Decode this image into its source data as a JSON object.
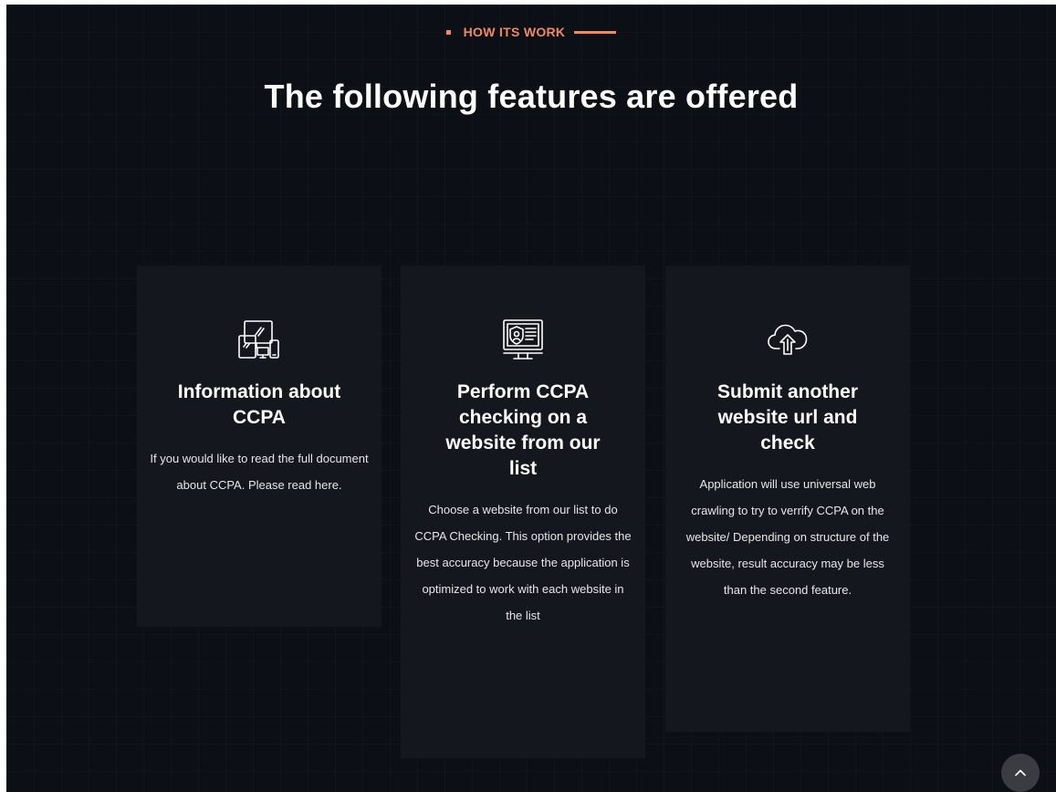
{
  "section": {
    "eyebrow": "HOW ITS WORK",
    "heading": "The following features are offered",
    "accent_color": "#f08a5d"
  },
  "cards": [
    {
      "icon": "devices-icon",
      "title": "Information about CCPA",
      "description": "If you would like to read the full document about CCPA. Please read here."
    },
    {
      "icon": "secure-monitor-icon",
      "title": "Perform CCPA checking on a website from our list",
      "description": "Choose a website from our list to do CCPA Checking. This option provides the best accuracy because the application is optimized to work with each website in the list"
    },
    {
      "icon": "cloud-upload-icon",
      "title": "Submit another website url and check",
      "description": "Application will use universal web crawling to try to verrify CCPA on the website/ Depending on structure of the website, result accuracy may be less than the second feature."
    }
  ],
  "scroll_top": {
    "icon": "chevron-up-icon"
  }
}
